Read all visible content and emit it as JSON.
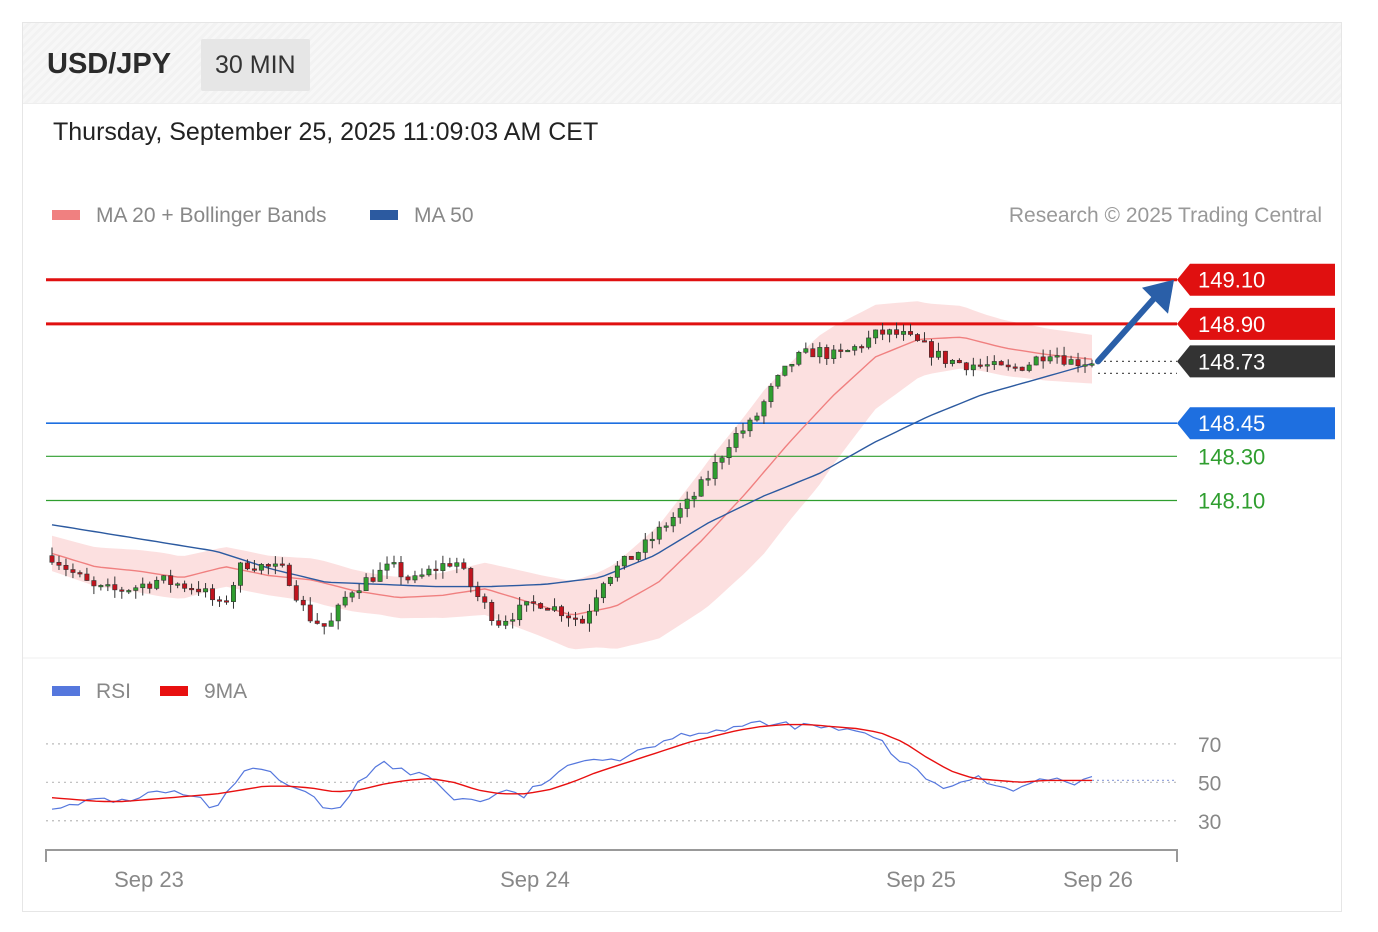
{
  "header": {
    "symbol": "USD/JPY",
    "timeframe": "30 MIN"
  },
  "timestamp": "Thursday, September 25, 2025 11:09:03 AM CET",
  "legend": {
    "ma20": {
      "label": "MA 20 + Bollinger Bands",
      "color": "#f08080"
    },
    "ma50": {
      "label": "MA 50",
      "color": "#2c5aa0"
    },
    "copyright": "Research © 2025 Trading Central"
  },
  "rsi_legend": {
    "rsi": {
      "label": "RSI",
      "color": "#5577dd"
    },
    "ma9": {
      "label": "9MA",
      "color": "#e81010"
    }
  },
  "colors": {
    "resistance": "#e01010",
    "support": "#2f9e2f",
    "ma50_line": "#1e6fe0",
    "current": "#333333",
    "arrow": "#2a5fa8",
    "band_fill": "#fbd6d6",
    "candle_up": "#2f9e2f",
    "candle_down": "#c0141e"
  },
  "chart_data": [
    {
      "type": "candlestick",
      "x_ticks": [
        "Sep 23",
        "Sep 24",
        "Sep 25",
        "Sep 26"
      ],
      "ylim": [
        147.4,
        149.28
      ],
      "levels": [
        {
          "label": "149.10",
          "value": 149.1,
          "kind": "resistance"
        },
        {
          "label": "148.90",
          "value": 148.9,
          "kind": "resistance"
        },
        {
          "label": "148.73",
          "value": 148.73,
          "kind": "current"
        },
        {
          "label": "148.45",
          "value": 148.45,
          "kind": "pivot"
        },
        {
          "label": "148.30",
          "value": 148.3,
          "kind": "support"
        },
        {
          "label": "148.10",
          "value": 148.1,
          "kind": "support"
        }
      ],
      "price_anchors": [
        147.85,
        147.77,
        147.7,
        147.69,
        147.71,
        147.74,
        147.72,
        147.7,
        147.61,
        147.82,
        147.8,
        147.78,
        147.58,
        147.52,
        147.69,
        147.75,
        147.8,
        147.73,
        147.79,
        147.83,
        147.67,
        147.55,
        147.6,
        147.64,
        147.6,
        147.55,
        147.75,
        147.82,
        147.9,
        148.0,
        148.09,
        148.22,
        148.38,
        148.45,
        148.62,
        148.74,
        148.78,
        148.75,
        148.8,
        148.86,
        148.85,
        148.8,
        148.74,
        148.72,
        148.71,
        148.69,
        148.72,
        148.78,
        148.73,
        148.73
      ],
      "ma50_anchors": [
        147.99,
        147.95,
        147.91,
        147.87,
        147.79,
        147.73,
        147.72,
        147.71,
        147.71,
        147.72,
        147.75,
        147.85,
        148.0,
        148.12,
        148.22,
        148.36,
        148.48,
        148.58,
        148.65,
        148.72
      ],
      "ma20_anchors": [
        147.86,
        147.8,
        147.78,
        147.75,
        147.8,
        147.76,
        147.74,
        147.69,
        147.66,
        147.67,
        147.7,
        147.64,
        147.58,
        147.62,
        147.73,
        147.92,
        148.13,
        148.36,
        148.57,
        148.75,
        148.83,
        148.84,
        148.79,
        148.76,
        148.74
      ],
      "band_width": [
        0.08,
        0.09,
        0.1,
        0.09,
        0.09,
        0.1,
        0.09,
        0.1,
        0.12,
        0.14,
        0.17,
        0.25,
        0.33,
        0.37,
        0.34,
        0.24,
        0.16,
        0.13,
        0.12,
        0.11
      ],
      "indicators": [
        "MA 20 + Bollinger Bands",
        "MA 50"
      ]
    },
    {
      "type": "line",
      "name": "RSI",
      "levels": [
        {
          "label": "70",
          "value": 70
        },
        {
          "label": "50",
          "value": 50
        },
        {
          "label": "30",
          "value": 30
        }
      ],
      "ylim": [
        20,
        85
      ],
      "rsi_values": [
        38,
        37,
        42,
        40,
        44,
        45,
        42,
        36,
        55,
        56,
        48,
        42,
        33,
        52,
        60,
        55,
        53,
        42,
        40,
        45,
        43,
        52,
        58,
        64,
        62,
        68,
        72,
        76,
        77,
        79,
        80,
        80,
        79,
        78,
        76,
        72,
        60,
        52,
        46,
        54,
        48,
        47,
        52,
        50,
        51
      ],
      "ma9_values": [
        42,
        41,
        40,
        40,
        41,
        42,
        43,
        44,
        46,
        48,
        48,
        47,
        45,
        46,
        49,
        51,
        52,
        50,
        46,
        44,
        44,
        46,
        50,
        55,
        59,
        63,
        67,
        71,
        74,
        77,
        79,
        80,
        80,
        79,
        78,
        76,
        71,
        63,
        56,
        52,
        51,
        50,
        51,
        51,
        51
      ],
      "x_ticks": [
        "Sep 23",
        "Sep 24",
        "Sep 25",
        "Sep 26"
      ]
    }
  ]
}
